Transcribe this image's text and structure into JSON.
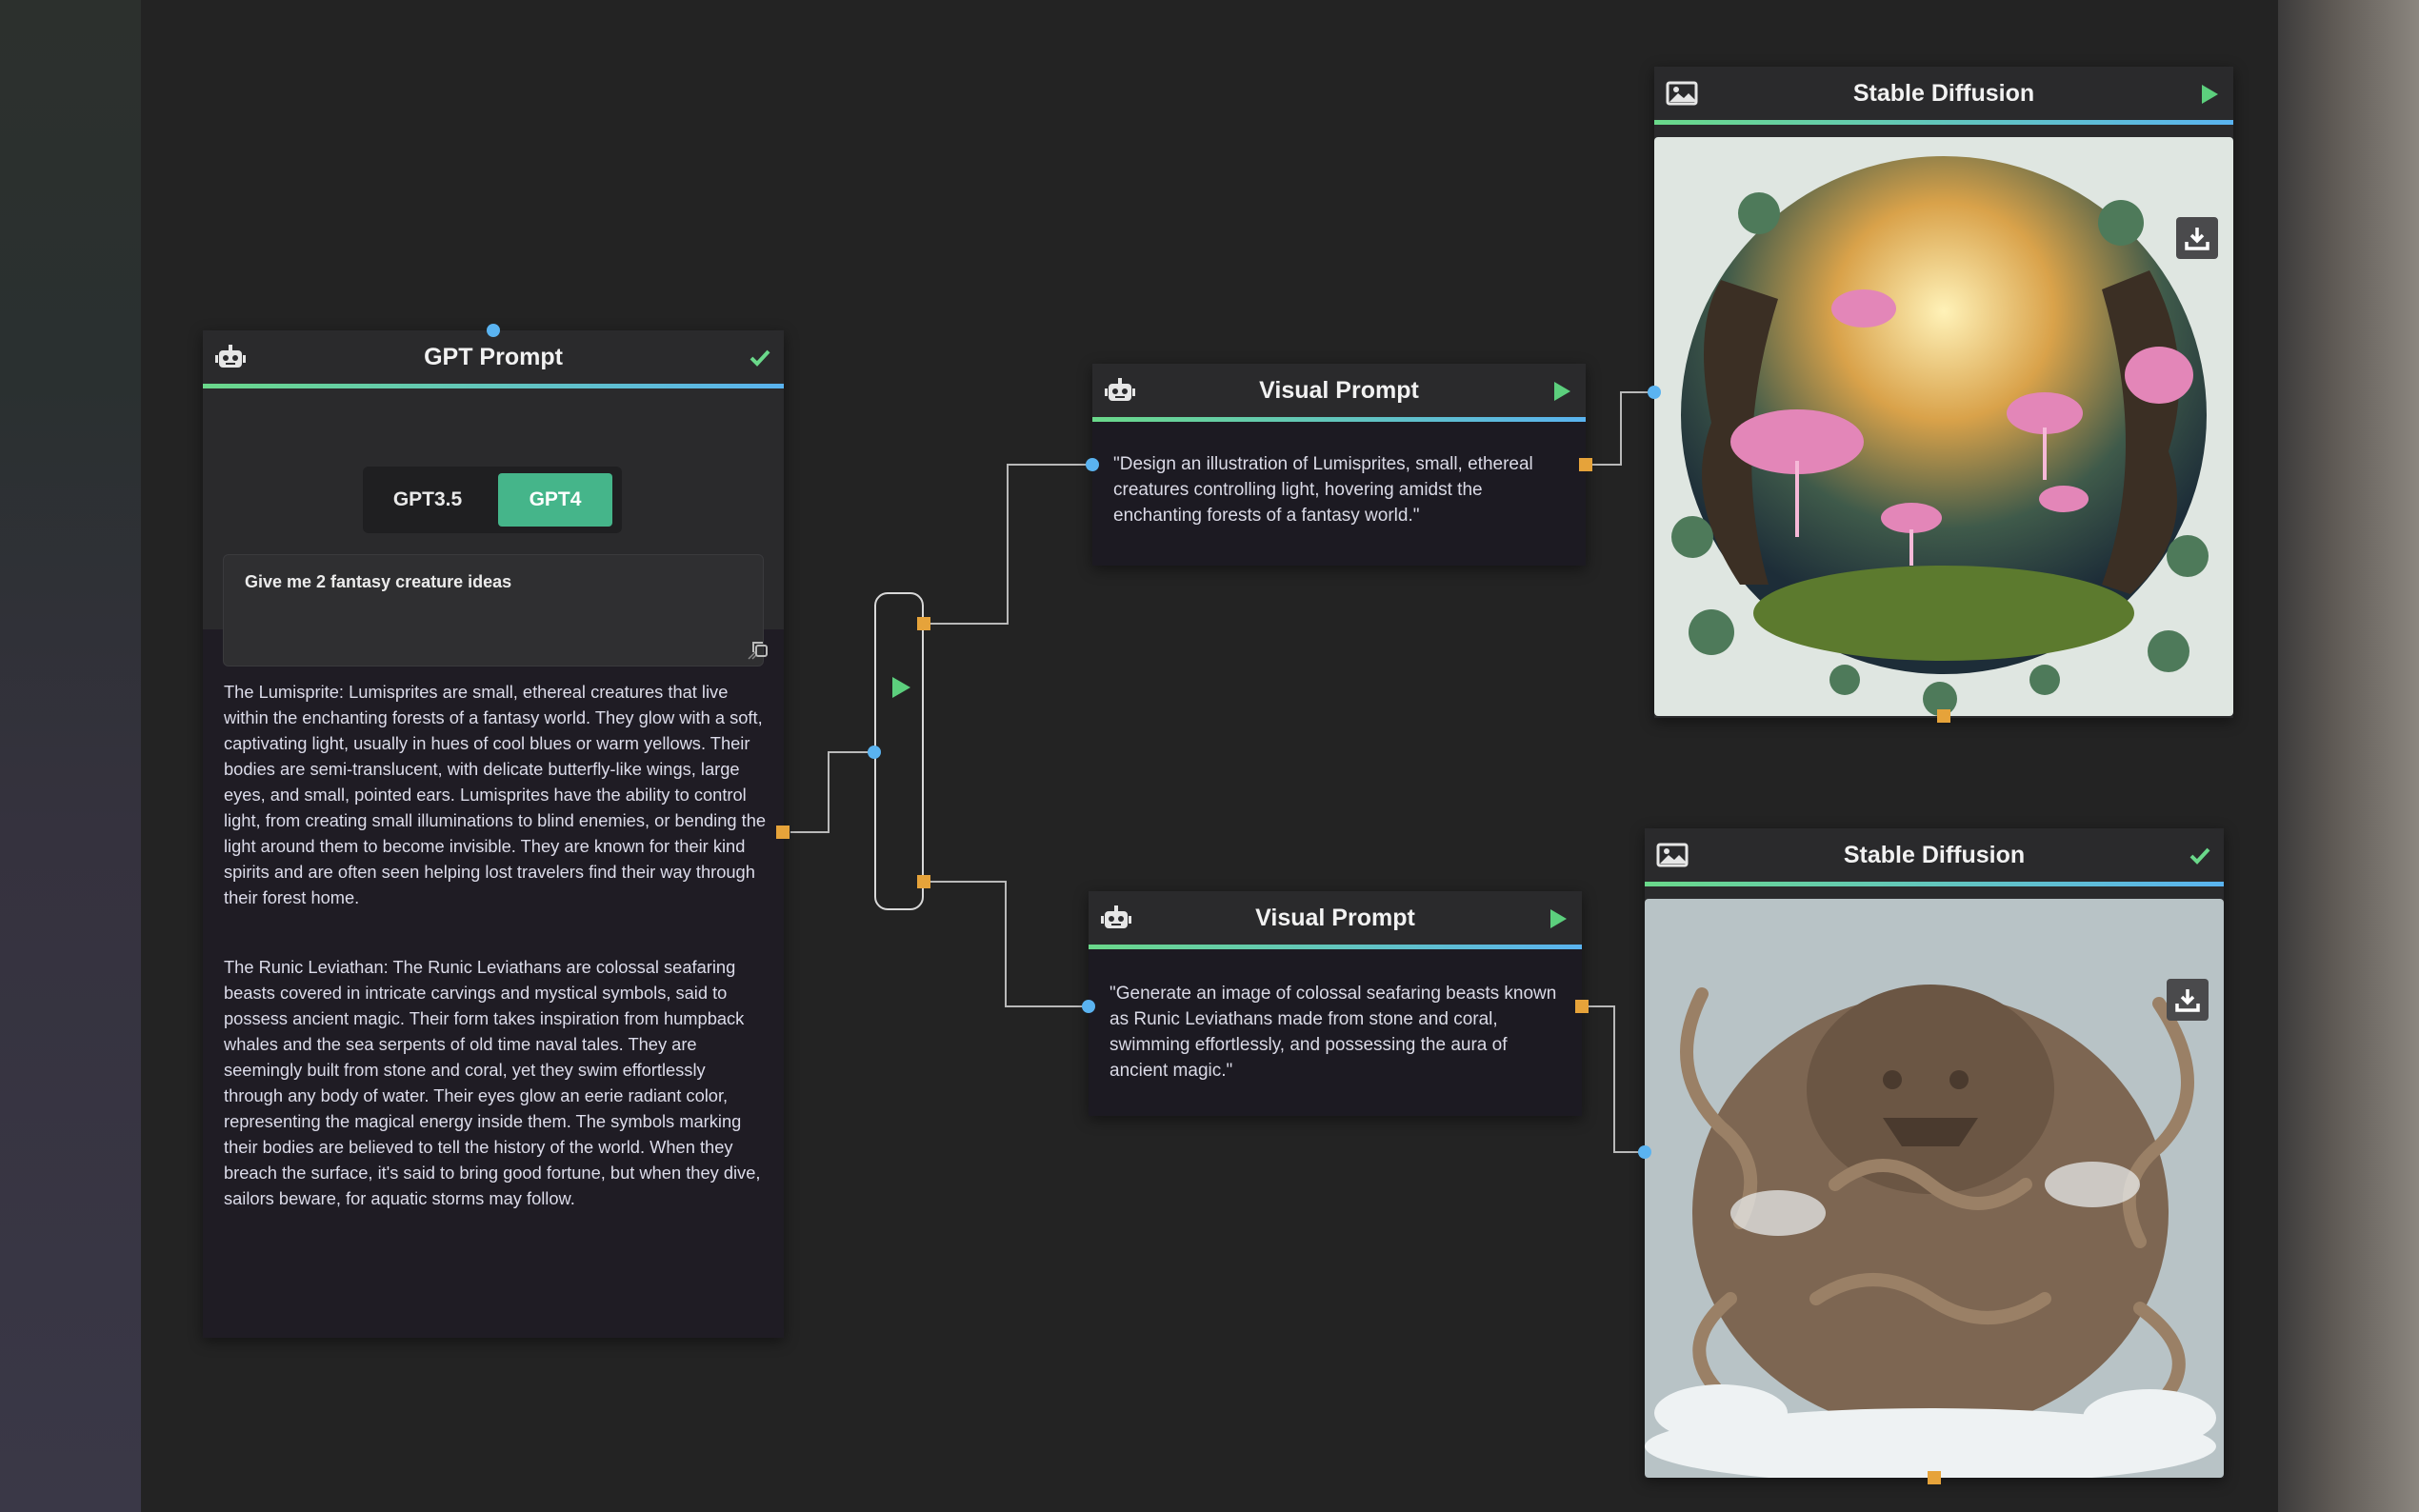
{
  "colors": {
    "accent_green": "#6ad88a",
    "accent_blue": "#5ab3f0",
    "port_out": "#e6a33a",
    "toggle_active": "#45b58a"
  },
  "gpt_node": {
    "title": "GPT Prompt",
    "icon": "robot-icon",
    "status_icon": "check-icon",
    "models": {
      "option_a": "GPT3.5",
      "option_b": "GPT4",
      "selected": "GPT4"
    },
    "prompt_value": "Give me 2 fantasy creature ideas",
    "output_paragraph_1": "The Lumisprite: Lumisprites are small, ethereal creatures that live within the enchanting forests of a fantasy world. They glow with a soft, captivating light, usually in hues of cool blues or warm yellows. Their bodies are semi-translucent, with delicate butterfly-like wings, large eyes, and small, pointed ears. Lumisprites have the ability to control light, from creating small illuminations to blind enemies, or bending the light around them to become invisible. They are known for their kind spirits and are often seen helping lost travelers find their way through their forest home.",
    "output_paragraph_2": "The Runic Leviathan: The Runic Leviathans are colossal seafaring beasts covered in intricate carvings and mystical symbols, said to possess ancient magic. Their form takes inspiration from humpback whales and the sea serpents of old time naval tales. They are seemingly built from stone and coral, yet they swim effortlessly through any body of water. Their eyes glow an eerie radiant color, representing the magical energy inside them. The symbols marking their bodies are believed to tell the history of the world. When they breach the surface, it's said to bring good fortune, but when they dive, sailors beware, for aquatic storms may follow."
  },
  "visual_prompt_1": {
    "title": "Visual Prompt",
    "icon": "robot-icon",
    "status_icon": "play-icon",
    "text": "\"Design an illustration of Lumisprites, small, ethereal creatures controlling light, hovering amidst the enchanting forests of a fantasy world.\""
  },
  "visual_prompt_2": {
    "title": "Visual Prompt",
    "icon": "robot-icon",
    "status_icon": "play-icon",
    "text": "\"Generate an image of colossal seafaring beasts known as Runic Leviathans made from stone and coral, swimming effortlessly, and possessing the aura of ancient magic.\""
  },
  "stable_diffusion_1": {
    "title": "Stable Diffusion",
    "icon": "image-icon",
    "status_icon": "play-icon",
    "action_icon": "download-icon"
  },
  "stable_diffusion_2": {
    "title": "Stable Diffusion",
    "icon": "image-icon",
    "status_icon": "check-icon",
    "action_icon": "download-icon"
  },
  "router": {
    "icon": "play-icon"
  }
}
